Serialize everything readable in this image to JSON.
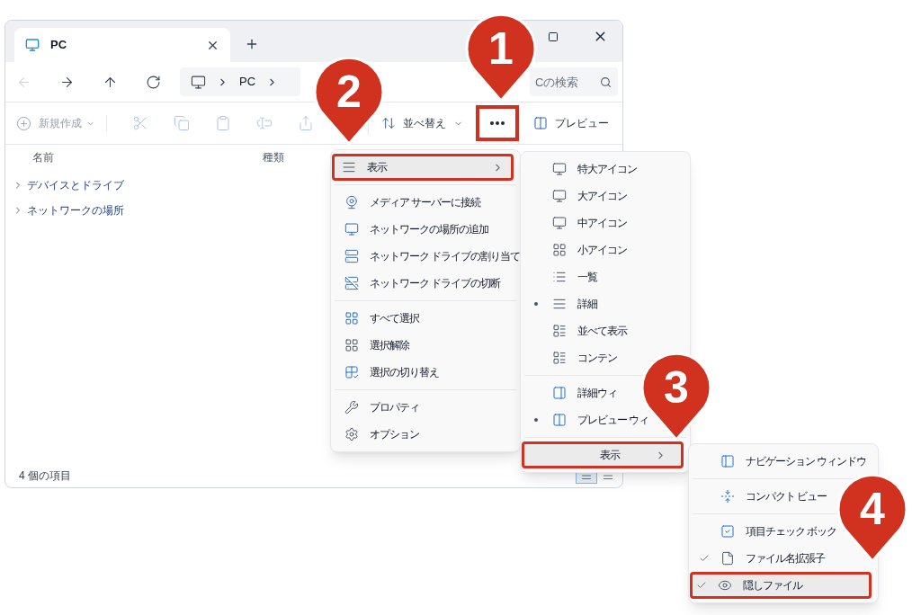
{
  "tab": {
    "label": "PC"
  },
  "nav": {
    "buttons": [
      {
        "disabled": true
      },
      {
        "disabled": false
      },
      {
        "disabled": false
      },
      {
        "disabled": false
      }
    ],
    "address": [
      "PC"
    ],
    "search": {
      "placeholder": "Cの検索"
    }
  },
  "toolbar": {
    "new": {
      "label": "新規作成",
      "disabled": true
    },
    "actions": [
      {
        "disabled": true
      },
      {
        "disabled": true
      },
      {
        "disabled": true
      },
      {
        "disabled": true
      },
      {
        "disabled": true
      }
    ],
    "sort": {
      "label": "並べ替え"
    },
    "more": {
      "highlighted": true
    },
    "preview": {
      "label": "プレビュー"
    }
  },
  "columns": [
    "名前",
    "種類"
  ],
  "tree": [
    {
      "label": "デバイスとドライブ",
      "expanded": false
    },
    {
      "label": "ネットワークの場所",
      "expanded": false
    }
  ],
  "status_bar": {
    "text": "4 個の項目",
    "view_toggle": [
      {
        "selected": true
      },
      {
        "selected": false
      }
    ]
  },
  "menu": {
    "groups": [
      [
        {
          "label": "表示",
          "kind": "submenu",
          "highlighted": true
        }
      ],
      [
        {
          "label": "メディア サーバーに接続",
          "kind": "item",
          "highlighted": false
        },
        {
          "label": "ネットワークの場所の追加",
          "kind": "item",
          "highlighted": false
        },
        {
          "label": "ネットワーク ドライブの割り当て",
          "kind": "item",
          "highlighted": false
        },
        {
          "label": "ネットワーク ドライブの切断",
          "kind": "item",
          "highlighted": false
        }
      ],
      [
        {
          "label": "すべて選択",
          "kind": "item",
          "highlighted": false
        },
        {
          "label": "選択解除",
          "kind": "item",
          "highlighted": false
        },
        {
          "label": "選択の切り替え",
          "kind": "item",
          "highlighted": false
        }
      ],
      [
        {
          "label": "プロパティ",
          "kind": "item",
          "highlighted": false
        },
        {
          "label": "オプション",
          "kind": "item",
          "highlighted": false
        }
      ]
    ]
  },
  "view_menu": {
    "groups": [
      [
        {
          "label": "特大アイコン",
          "kind": "item",
          "checked": false,
          "highlighted": false
        },
        {
          "label": "大アイコン",
          "kind": "item",
          "checked": false,
          "highlighted": false
        },
        {
          "label": "中アイコン",
          "kind": "item",
          "checked": false,
          "highlighted": false
        },
        {
          "label": "小アイコン",
          "kind": "item",
          "checked": false,
          "highlighted": false
        },
        {
          "label": "一覧",
          "kind": "item",
          "checked": false,
          "highlighted": false
        },
        {
          "label": "詳細",
          "kind": "item",
          "checked": true,
          "highlighted": false
        },
        {
          "label": "並べて表示",
          "kind": "item",
          "checked": false,
          "highlighted": false
        },
        {
          "label": "コンテン",
          "kind": "item",
          "checked": false,
          "highlighted": false
        }
      ],
      [
        {
          "label": "詳細ウィ",
          "kind": "item",
          "checked": false,
          "highlighted": false
        },
        {
          "label": "プレビュー ウィ",
          "kind": "item",
          "checked": true,
          "highlighted": false
        }
      ],
      [
        {
          "label": "表示",
          "kind": "submenu",
          "checked": false,
          "highlighted": true
        }
      ]
    ]
  },
  "show_menu": {
    "groups": [
      [
        {
          "label": "ナビゲーション ウィンドウ",
          "checked": false,
          "highlighted": false
        }
      ],
      [
        {
          "label": "コンパクト ビュー",
          "checked": false,
          "highlighted": false
        }
      ],
      [
        {
          "label": "項目チェック ボック",
          "checked": false,
          "highlighted": false
        },
        {
          "label": "ファイル名拡張子",
          "checked": true,
          "highlighted": false
        },
        {
          "label": "隠しファイル",
          "checked": true,
          "highlighted": true
        }
      ]
    ]
  },
  "callouts": [
    {
      "label": "1"
    },
    {
      "label": "2"
    },
    {
      "label": "3"
    },
    {
      "label": "4"
    }
  ]
}
